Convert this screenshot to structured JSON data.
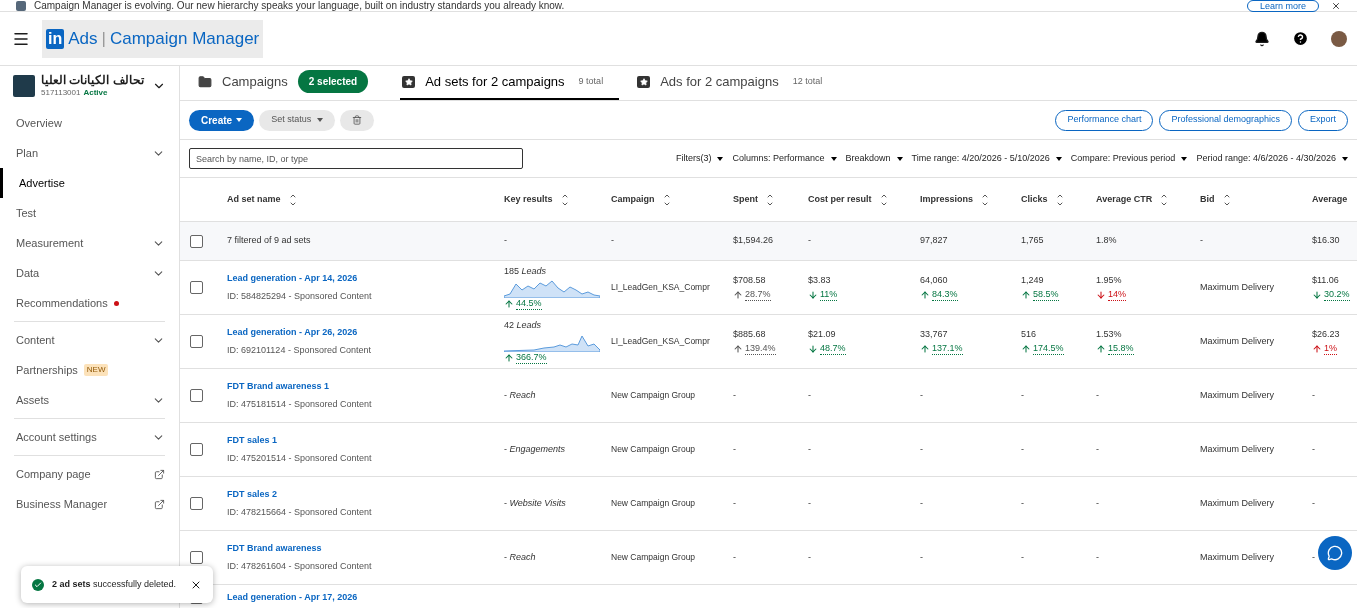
{
  "banner": {
    "text": "Campaign Manager is evolving. Our new hierarchy speaks your language, built on industry standards you already know.",
    "action": "Learn more"
  },
  "header": {
    "logo_mark": "in",
    "product": "Ads",
    "separator": "|",
    "title": "Campaign Manager"
  },
  "account": {
    "name": "تحالف الكيانات العليا",
    "id": "517113001",
    "status": "Active"
  },
  "sidebar": {
    "items": [
      {
        "label": "Overview",
        "kind": "plain",
        "selected": false
      },
      {
        "label": "Plan",
        "kind": "expandable",
        "selected": false
      },
      {
        "label": "Advertise",
        "kind": "plain",
        "selected": true
      },
      {
        "label": "Test",
        "kind": "plain",
        "selected": false
      },
      {
        "label": "Measurement",
        "kind": "expandable",
        "selected": false
      },
      {
        "label": "Data",
        "kind": "expandable",
        "selected": false
      },
      {
        "label": "Recommendations",
        "kind": "plain",
        "selected": false,
        "alert": true
      },
      {
        "label": "Content",
        "kind": "expandable",
        "selected": false,
        "divider_before": true
      },
      {
        "label": "Partnerships",
        "kind": "plain",
        "selected": false,
        "badge": "NEW"
      },
      {
        "label": "Assets",
        "kind": "expandable",
        "selected": false
      },
      {
        "label": "Account settings",
        "kind": "expandable",
        "selected": false,
        "divider_before": true
      },
      {
        "label": "Company page",
        "kind": "external",
        "selected": false,
        "divider_before": true
      },
      {
        "label": "Business Manager",
        "kind": "external",
        "selected": false
      }
    ]
  },
  "tabs": [
    {
      "label": "Campaigns",
      "kind": "folder",
      "selected": false,
      "badge": "2 selected"
    },
    {
      "label": "Ad sets for 2 campaigns",
      "kind": "star",
      "selected": true,
      "count": "9 total"
    },
    {
      "label": "Ads for 2 campaigns",
      "kind": "star",
      "selected": false,
      "count": "12 total"
    }
  ],
  "toolbar": {
    "create": "Create",
    "set_status": "Set status",
    "right_buttons": [
      "Performance chart",
      "Professional demographics",
      "Export"
    ]
  },
  "filters": {
    "search_placeholder": "Search by name, ID, or type",
    "menus": [
      "Filters(3)",
      "Columns: Performance",
      "Breakdown",
      "Time range: 4/20/2026 - 5/10/2026",
      "Compare: Previous period",
      "Period range: 4/6/2026 - 4/30/2026"
    ]
  },
  "table": {
    "columns": [
      "Ad set name",
      "Key results",
      "Campaign",
      "Spent",
      "Cost per result",
      "Impressions",
      "Clicks",
      "Average CTR",
      "Bid",
      "Average"
    ],
    "summary": {
      "checked": false,
      "label": "7 filtered of 9 ad sets",
      "cells": [
        "-",
        "-",
        "$1,594.26",
        "-",
        "97,827",
        "1,765",
        "1.8%",
        "-",
        "$16.30"
      ]
    },
    "rows": [
      {
        "checked": false,
        "name": "Lead generation - Apr 14, 2026",
        "meta": "ID: 584825294 - Sponsored Content",
        "key": {
          "kind": "chart",
          "value": "185",
          "unit": "Leads",
          "change": {
            "text": "44.5%",
            "rising": true,
            "color": "#057642"
          }
        },
        "campaign": "LI_LeadGen_KSA_Compr",
        "cells": [
          {
            "value": "$708.58",
            "change": {
              "text": "28.7%",
              "rising": true,
              "color": "#555555"
            }
          },
          {
            "value": "$3.83",
            "change": {
              "text": "11%",
              "rising": false,
              "color": "#057642"
            }
          },
          {
            "value": "64,060",
            "change": {
              "text": "84.3%",
              "rising": true,
              "color": "#057642"
            }
          },
          {
            "value": "1,249",
            "change": {
              "text": "58.5%",
              "rising": true,
              "color": "#057642"
            }
          },
          {
            "value": "1.95%",
            "change": {
              "text": "14%",
              "rising": false,
              "color": "#cc1016"
            }
          },
          {
            "value": "Maximum Delivery"
          },
          {
            "value": "$11.06",
            "change": {
              "text": "30.2%",
              "rising": false,
              "color": "#057642"
            }
          }
        ]
      },
      {
        "checked": false,
        "name": "Lead generation - Apr 26, 2026",
        "meta": "ID: 692101124 - Sponsored Content",
        "key": {
          "kind": "chart",
          "value": "42",
          "unit": "Leads",
          "change": {
            "text": "366.7%",
            "rising": true,
            "color": "#057642"
          }
        },
        "campaign": "LI_LeadGen_KSA_Compr",
        "cells": [
          {
            "value": "$885.68",
            "change": {
              "text": "139.4%",
              "rising": true,
              "color": "#555555"
            }
          },
          {
            "value": "$21.09",
            "change": {
              "text": "48.7%",
              "rising": false,
              "color": "#057642"
            }
          },
          {
            "value": "33,767",
            "change": {
              "text": "137.1%",
              "rising": true,
              "color": "#057642"
            }
          },
          {
            "value": "516",
            "change": {
              "text": "174.5%",
              "rising": true,
              "color": "#057642"
            }
          },
          {
            "value": "1.53%",
            "change": {
              "text": "15.8%",
              "rising": true,
              "color": "#057642"
            }
          },
          {
            "value": "Maximum Delivery"
          },
          {
            "value": "$26.23",
            "change": {
              "text": "1%",
              "rising": true,
              "color": "#cc1016"
            }
          }
        ]
      },
      {
        "checked": false,
        "name": "FDT Brand awareness 1",
        "meta": "ID: 475181514 - Sponsored Content",
        "key": {
          "kind": "text",
          "value": "-",
          "unit": "Reach"
        },
        "campaign": "New Campaign Group",
        "cells": [
          {
            "value": "-"
          },
          {
            "value": "-"
          },
          {
            "value": "-"
          },
          {
            "value": "-"
          },
          {
            "value": "-"
          },
          {
            "value": "Maximum Delivery"
          },
          {
            "value": "-"
          }
        ]
      },
      {
        "checked": false,
        "name": "FDT sales 1",
        "meta": "ID: 475201514 - Sponsored Content",
        "key": {
          "kind": "text",
          "value": "-",
          "unit": "Engagements"
        },
        "campaign": "New Campaign Group",
        "cells": [
          {
            "value": "-"
          },
          {
            "value": "-"
          },
          {
            "value": "-"
          },
          {
            "value": "-"
          },
          {
            "value": "-"
          },
          {
            "value": "Maximum Delivery"
          },
          {
            "value": "-"
          }
        ]
      },
      {
        "checked": false,
        "name": "FDT sales 2",
        "meta": "ID: 478215664 - Sponsored Content",
        "key": {
          "kind": "text",
          "value": "-",
          "unit": "Website Visits"
        },
        "campaign": "New Campaign Group",
        "cells": [
          {
            "value": "-"
          },
          {
            "value": "-"
          },
          {
            "value": "-"
          },
          {
            "value": "-"
          },
          {
            "value": "-"
          },
          {
            "value": "Maximum Delivery"
          },
          {
            "value": "-"
          }
        ]
      },
      {
        "checked": false,
        "name": "FDT Brand awareness",
        "meta": "ID: 478261604 - Sponsored Content",
        "key": {
          "kind": "text",
          "value": "-",
          "unit": "Reach"
        },
        "campaign": "New Campaign Group",
        "cells": [
          {
            "value": "-"
          },
          {
            "value": "-"
          },
          {
            "value": "-"
          },
          {
            "value": "-"
          },
          {
            "value": "-"
          },
          {
            "value": "Maximum Delivery"
          },
          {
            "value": "-"
          }
        ]
      },
      {
        "checked": false,
        "name": "Lead generation - Apr 17, 2026"
      }
    ]
  },
  "toast": {
    "message": "**2 ad sets** successfully deleted."
  }
}
